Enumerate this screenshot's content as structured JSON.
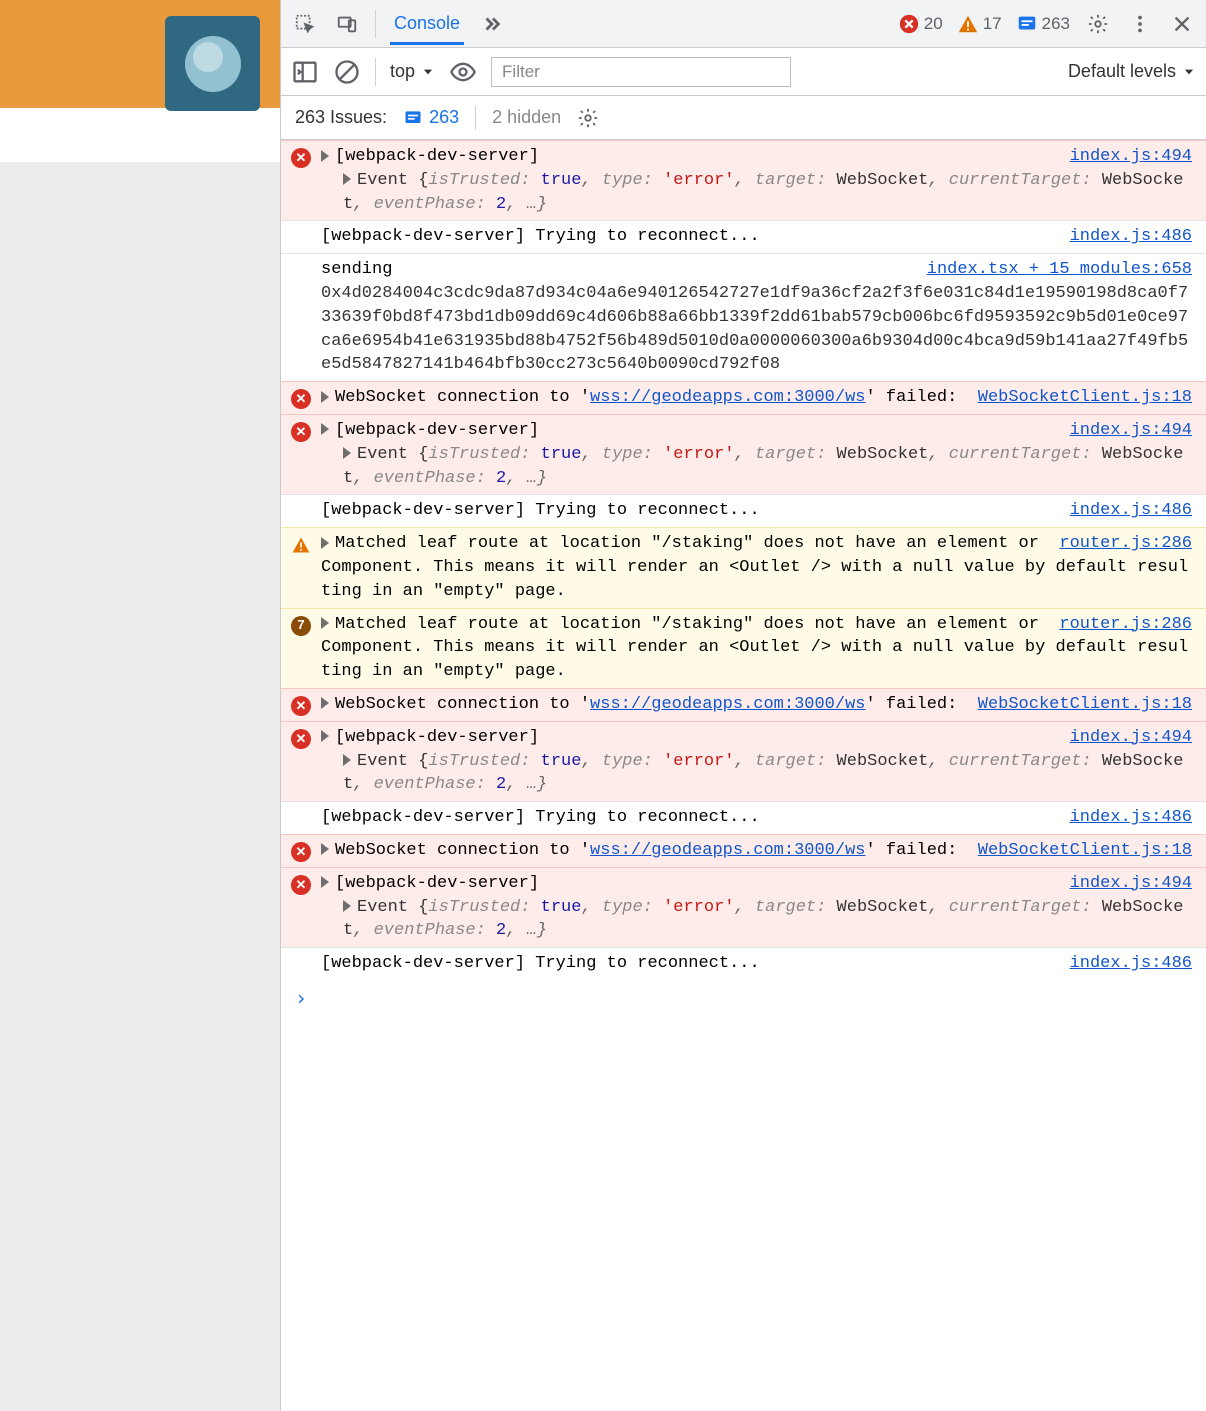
{
  "tabbar": {
    "console_label": "Console",
    "errors": "20",
    "warnings": "17",
    "issues": "263"
  },
  "filterbar": {
    "context": "top",
    "filter_placeholder": "Filter",
    "levels": "Default levels"
  },
  "issuesbar": {
    "label": "263 Issues:",
    "count": "263",
    "hidden": "2 hidden"
  },
  "rows": {
    "wds_label": "[webpack-dev-server]",
    "wds_event_src": "index.js:494",
    "event_dump": {
      "open": "Event {",
      "k1": "isTrusted:",
      "v1": "true",
      "k2": "type:",
      "v2": "'error'",
      "k3": "target:",
      "v3": "WebSocket",
      "k4": "currentTarget:",
      "v4": "WebSocket",
      "k5": "eventPhase:",
      "v5": "2",
      "close": ", …}"
    },
    "reconnect_text": "[webpack-dev-server] Trying to reconnect...",
    "reconnect_src": "index.js:486",
    "sending_label": "sending",
    "sending_src": "index.tsx + 15 modules:658",
    "sending_hex": "0x4d0284004c3cdc9da87d934c04a6e940126542727e1df9a36cf2a2f3f6e031c84d1e19590198d8ca0f733639f0bd8f473bd1db09dd69c4d606b88a66bb1339f2dd61bab579cb006bc6fd9593592c9b5d01e0ce97ca6e6954b41e631935bd88b4752f56b489d5010d0a0000060300a6b9304d00c4bca9d59b141aa27f49fb5e5d5847827141b464bfb30cc273c5640b0090cd792f08",
    "ws_fail_pre": "WebSocket connection to '",
    "ws_fail_url": "wss://geodeapps.com:3000/ws",
    "ws_fail_post": "' failed:",
    "ws_fail_src": "WebSocketClient.js:18",
    "route_warn_text": "Matched leaf route at location \"/staking\" does not have an element or Component. This means it will render an <Outlet /> with a null value by default resulting in an \"empty\" page.",
    "route_warn_src": "router.js:286",
    "route_repeat_badge": "7"
  },
  "prompt": "›"
}
